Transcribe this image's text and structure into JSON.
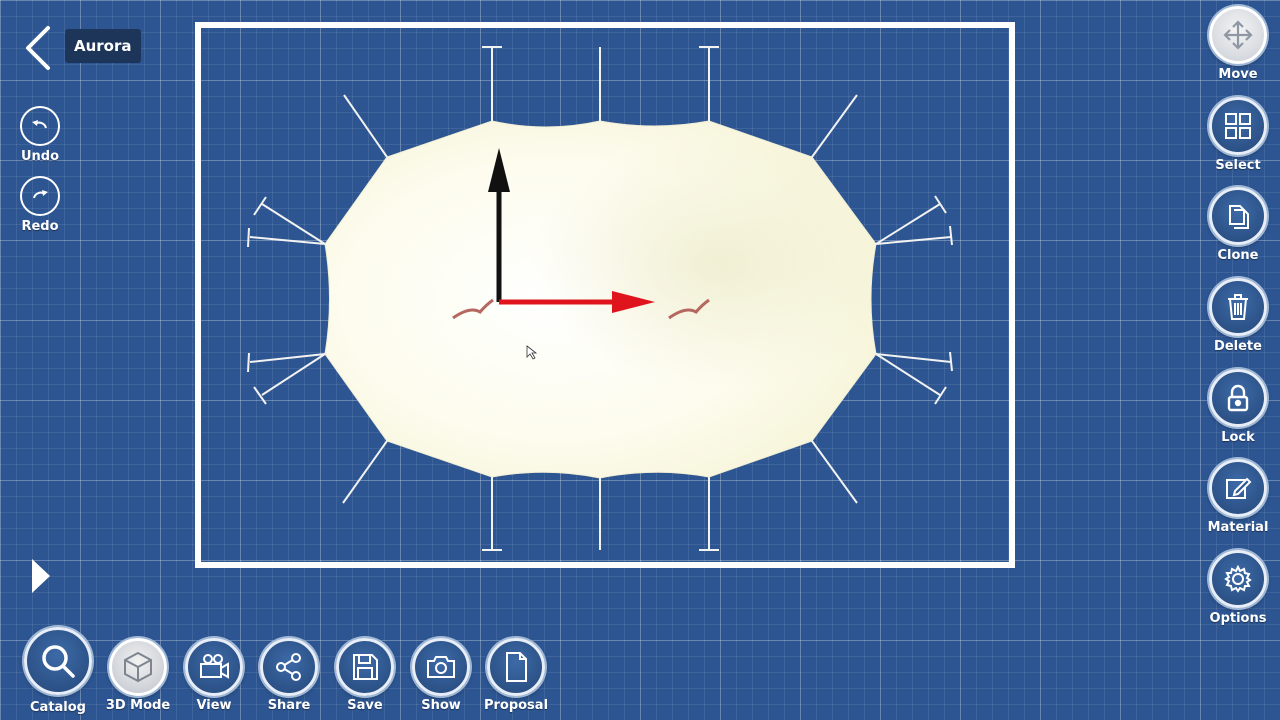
{
  "header": {
    "title": "Aurora"
  },
  "left_tools": {
    "undo_label": "Undo",
    "redo_label": "Redo"
  },
  "right_toolbar": [
    {
      "label": "Move",
      "icon": "move-icon",
      "active": true
    },
    {
      "label": "Select",
      "icon": "select-icon"
    },
    {
      "label": "Clone",
      "icon": "clone-icon"
    },
    {
      "label": "Delete",
      "icon": "trash-icon"
    },
    {
      "label": "Lock",
      "icon": "lock-icon"
    },
    {
      "label": "Material",
      "icon": "edit-icon"
    },
    {
      "label": "Options",
      "icon": "gear-icon"
    }
  ],
  "bottom_toolbar": [
    {
      "label": "Catalog",
      "icon": "search-icon"
    },
    {
      "label": "3D Mode",
      "icon": "cube-icon",
      "active": true
    },
    {
      "label": "View",
      "icon": "camera-icon"
    },
    {
      "label": "Share",
      "icon": "share-icon"
    },
    {
      "label": "Save",
      "icon": "save-icon"
    },
    {
      "label": "Show",
      "icon": "photo-icon"
    },
    {
      "label": "Proposal",
      "icon": "document-icon"
    }
  ],
  "colors": {
    "background": "#2c5591",
    "canvas_border": "#ffffff",
    "membrane": "#fdfbe9",
    "axis_x": "#e0141c",
    "axis_y": "#111111"
  }
}
